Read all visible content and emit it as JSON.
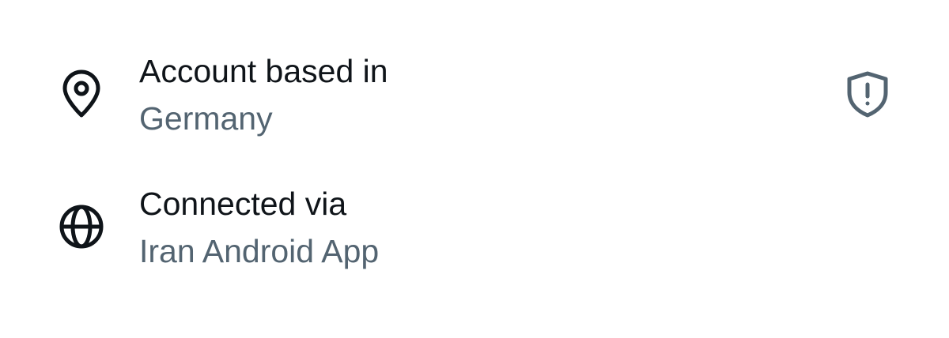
{
  "colors": {
    "primary_text": "#0f1419",
    "secondary_text": "#536471",
    "icon": "#0f1419",
    "shield_icon": "#536471",
    "background": "#ffffff"
  },
  "account_location": {
    "icon": "location-pin-icon",
    "label": "Account based in",
    "value": "Germany",
    "action_icon": "shield-alert-icon"
  },
  "connection": {
    "icon": "globe-icon",
    "label": "Connected via",
    "value": "Iran Android App"
  }
}
